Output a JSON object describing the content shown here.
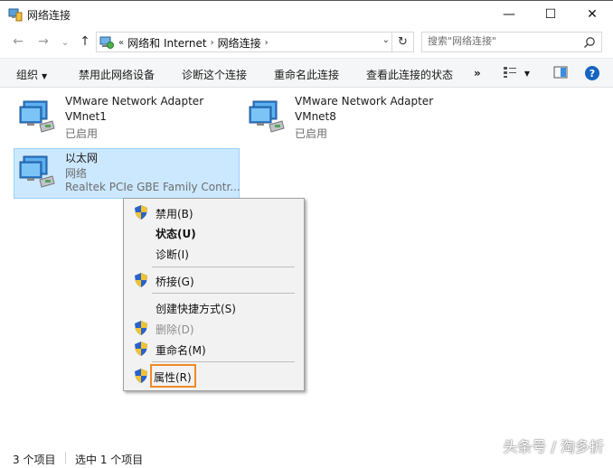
{
  "window": {
    "title": "网络连接",
    "minimize_glyph": "—",
    "maximize_glyph": "☐",
    "close_glyph": "✕"
  },
  "address": {
    "back_glyph": "←",
    "forward_glyph": "→",
    "recent_glyph": "⌄",
    "up_glyph": "↑",
    "chevron_glyph": "«",
    "breadcrumbs": [
      "网络和 Internet",
      "网络连接"
    ],
    "refresh_glyph": "↻",
    "dropdown_glyph": "⌄"
  },
  "search": {
    "placeholder": "搜索\"网络连接\""
  },
  "toolbar": {
    "organize": "组织",
    "disable_device": "禁用此网络设备",
    "diagnose": "诊断这个连接",
    "rename": "重命名此连接",
    "view_status": "查看此连接的状态",
    "more": "»",
    "dd_glyph": "▼"
  },
  "items": [
    {
      "name": "VMware Network Adapter",
      "line2": "VMnet1",
      "line3": "已启用"
    },
    {
      "name": "VMware Network Adapter",
      "line2": "VMnet8",
      "line3": "已启用"
    },
    {
      "name": "以太网",
      "line2": "网络",
      "line3": "Realtek PCIe GBE Family Contr..."
    }
  ],
  "context_menu": {
    "items": [
      {
        "label": "禁用(B)",
        "shield": true
      },
      {
        "label": "状态(U)",
        "bold": true
      },
      {
        "label": "诊断(I)"
      },
      {
        "label": "桥接(G)",
        "shield": true
      },
      {
        "label": "创建快捷方式(S)"
      },
      {
        "label": "删除(D)",
        "shield": true,
        "disabled": true
      },
      {
        "label": "重命名(M)",
        "shield": true
      },
      {
        "label": "属性(R)",
        "shield": true,
        "highlighted": true
      }
    ]
  },
  "status": {
    "count": "3 个项目",
    "selected": "选中 1 个项目"
  },
  "watermark": "头条号 / 淘多折",
  "colors": {
    "selection_bg": "#cce8ff",
    "selection_border": "#99d1ff",
    "highlight_outline": "#f08a24",
    "help_blue": "#1565c0"
  }
}
